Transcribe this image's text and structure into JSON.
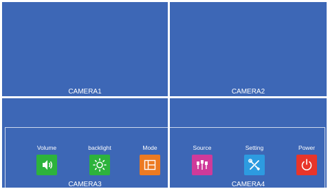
{
  "cameras": [
    {
      "label": "CAMERA1"
    },
    {
      "label": "CAMERA2"
    },
    {
      "label": "CAMERA3"
    },
    {
      "label": "CAMERA4"
    }
  ],
  "menu": {
    "items": [
      {
        "label": "Volume",
        "icon": "speaker-icon",
        "color": "#2db33c"
      },
      {
        "label": "backlight",
        "icon": "brightness-icon",
        "color": "#2db33c"
      },
      {
        "label": "Mode",
        "icon": "layout-icon",
        "color": "#ec7a22"
      },
      {
        "label": "Source",
        "icon": "plug-icon",
        "color": "#cf3a9a"
      },
      {
        "label": "Setting",
        "icon": "tools-icon",
        "color": "#2d9be0"
      },
      {
        "label": "Power",
        "icon": "power-icon",
        "color": "#e8352a"
      }
    ]
  },
  "colors": {
    "background": "#3d67b6",
    "divider": "#ffffff"
  }
}
